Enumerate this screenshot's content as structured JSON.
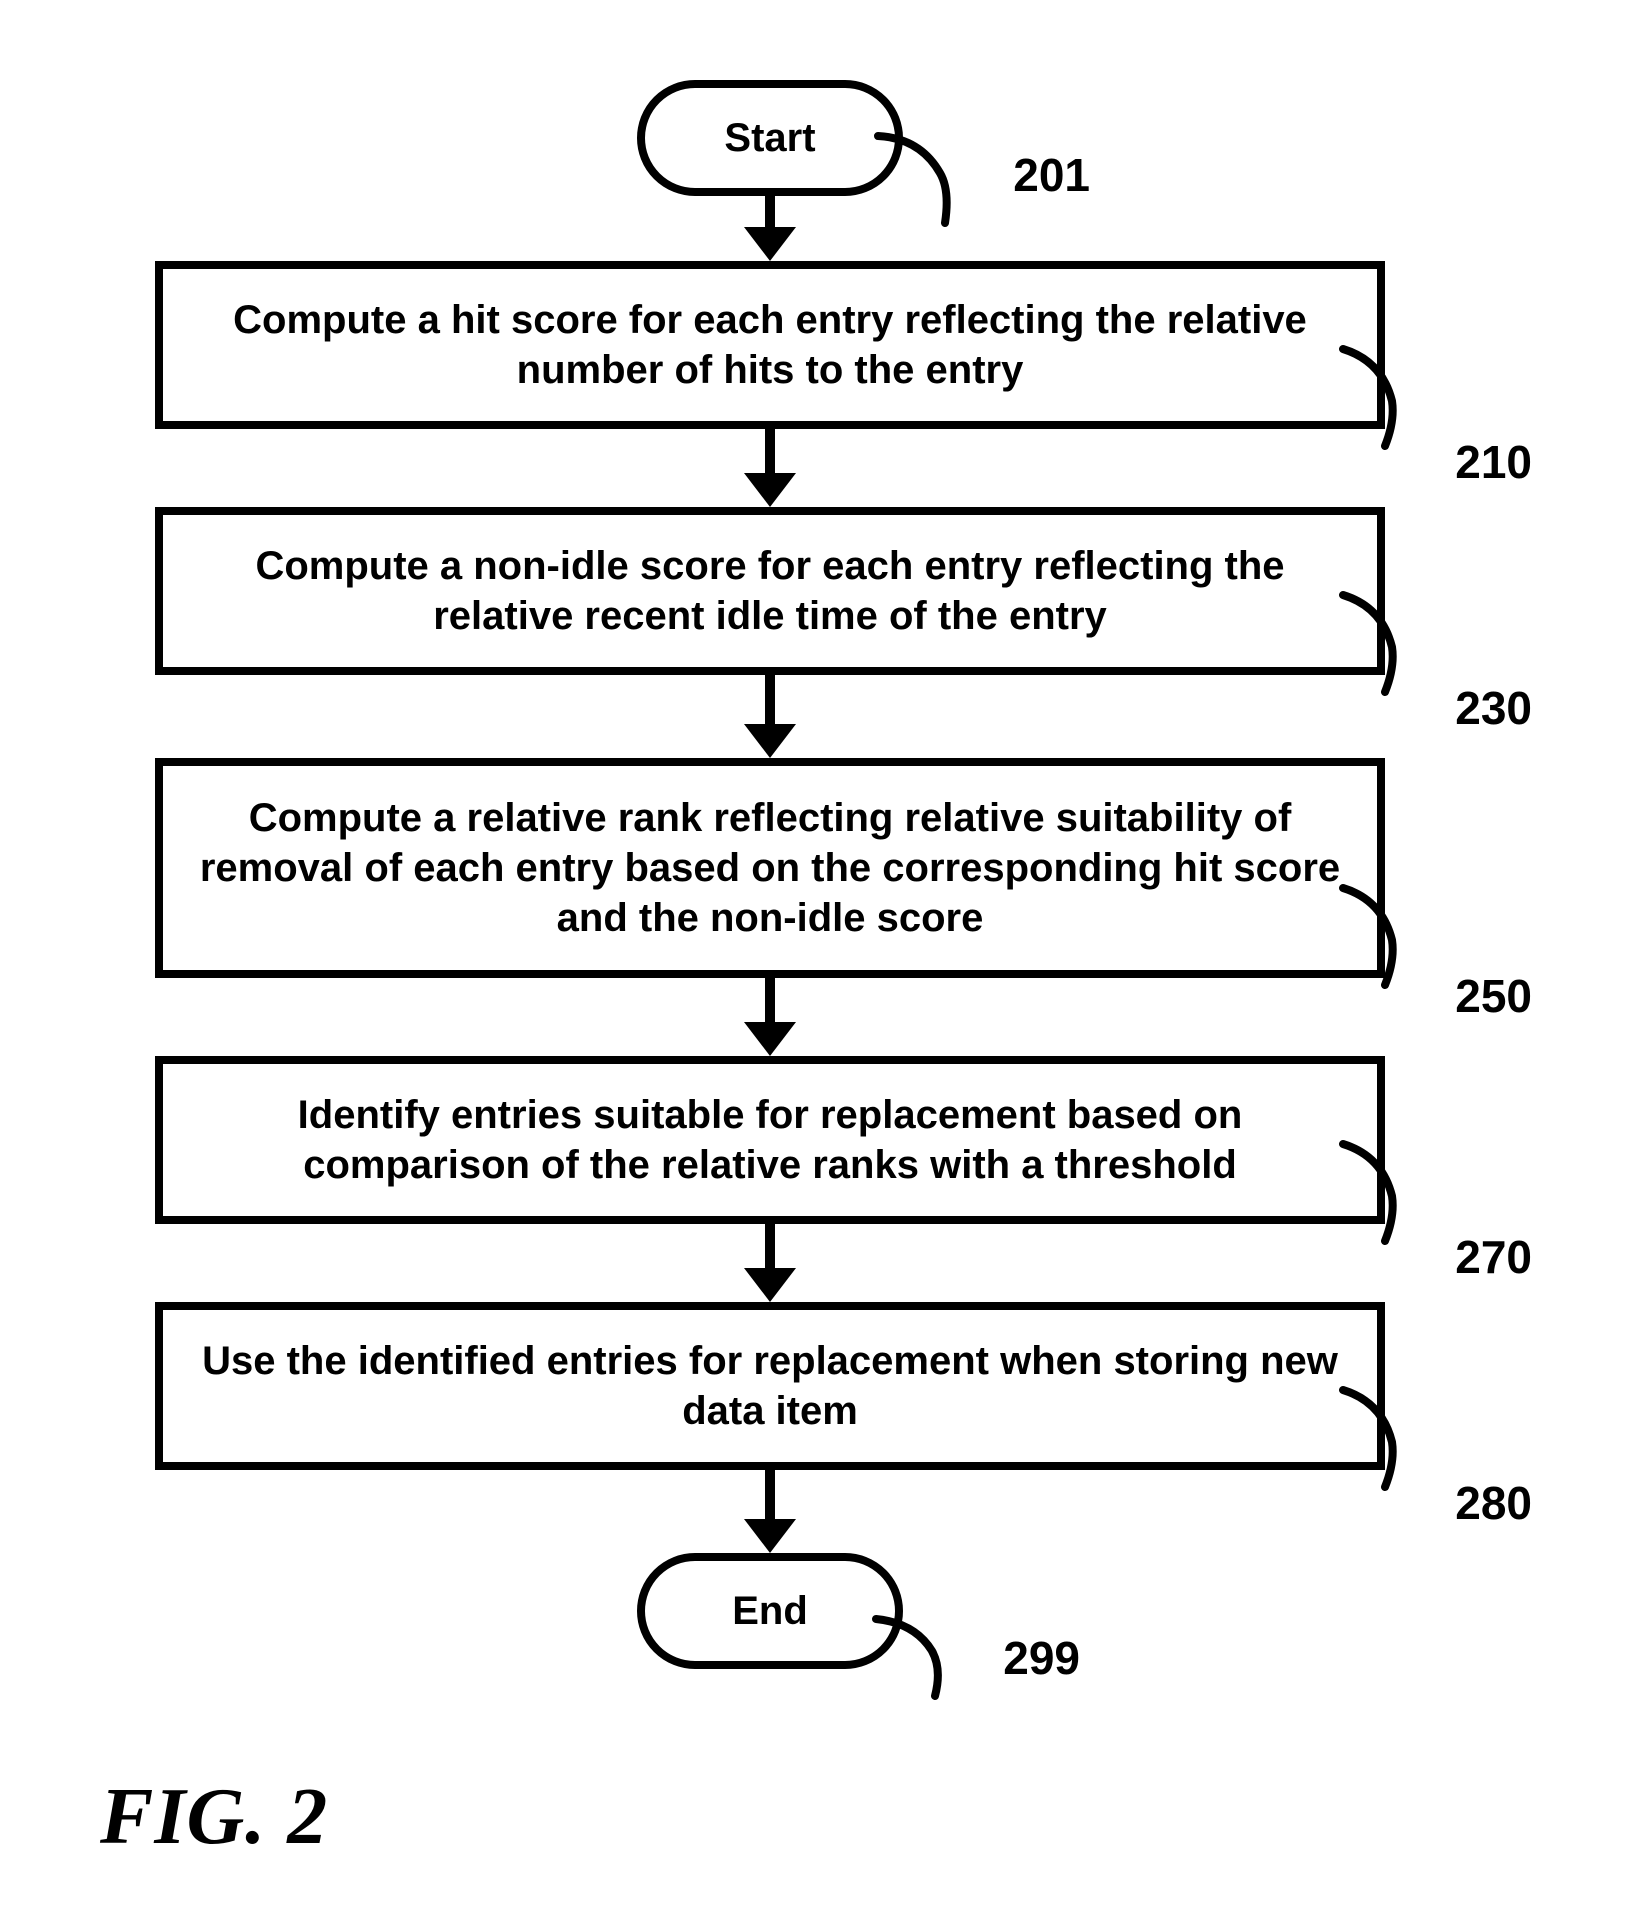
{
  "diagram": {
    "title": "FIG. 2",
    "type": "flowchart",
    "nodes": {
      "start": {
        "label": "Start",
        "ref": "201",
        "shape": "terminal"
      },
      "step210": {
        "label": "Compute a hit score for each entry reflecting the relative number of hits to the entry",
        "ref": "210",
        "shape": "process"
      },
      "step230": {
        "label": "Compute a non-idle score for each entry reflecting the relative recent idle time of the entry",
        "ref": "230",
        "shape": "process"
      },
      "step250": {
        "label": "Compute a relative rank reflecting relative suitability of removal of each entry based on the corresponding hit score and the non-idle score",
        "ref": "250",
        "shape": "process"
      },
      "step270": {
        "label": "Identify entries suitable for replacement based on comparison of the relative ranks with a threshold",
        "ref": "270",
        "shape": "process"
      },
      "step280": {
        "label": "Use the identified entries for replacement when storing new data item",
        "ref": "280",
        "shape": "process"
      },
      "end": {
        "label": "End",
        "ref": "299",
        "shape": "terminal"
      }
    },
    "edges": [
      [
        "start",
        "step210"
      ],
      [
        "step210",
        "step230"
      ],
      [
        "step230",
        "step250"
      ],
      [
        "step250",
        "step270"
      ],
      [
        "step270",
        "step280"
      ],
      [
        "step280",
        "end"
      ]
    ]
  }
}
